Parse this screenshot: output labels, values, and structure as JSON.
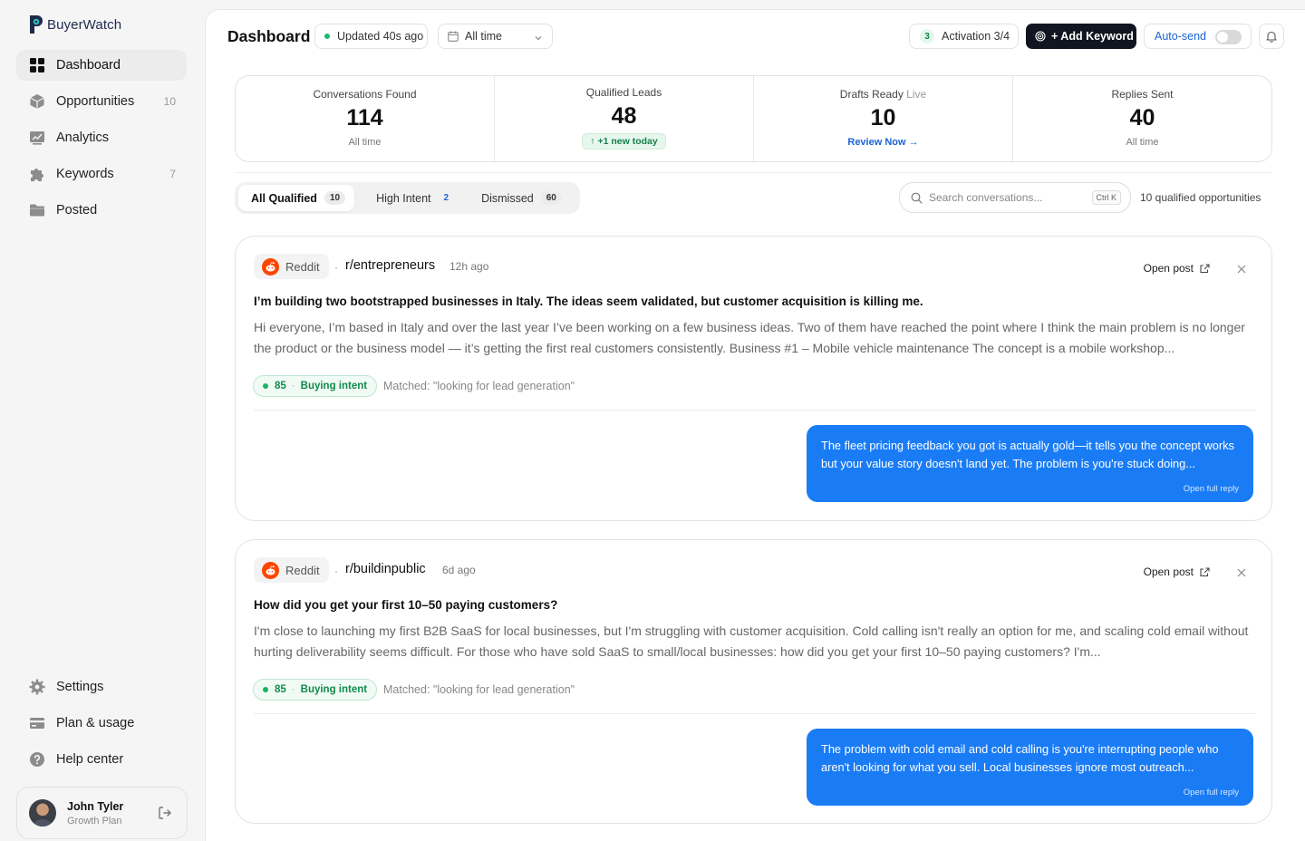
{
  "app": {
    "name": "BuyerWatch"
  },
  "sidebar": {
    "items": [
      {
        "label": "Dashboard",
        "count": ""
      },
      {
        "label": "Opportunities",
        "count": "10"
      },
      {
        "label": "Analytics",
        "count": ""
      },
      {
        "label": "Keywords",
        "count": "7"
      },
      {
        "label": "Posted",
        "count": ""
      }
    ],
    "bottom": [
      {
        "label": "Settings"
      },
      {
        "label": "Plan & usage"
      },
      {
        "label": "Help center"
      }
    ],
    "user": {
      "name": "John Tyler",
      "plan": "Growth Plan"
    }
  },
  "header": {
    "title": "Dashboard",
    "updated": "Updated 40s ago",
    "time_filter": "All time",
    "activation_num": "3",
    "activation_label": "Activation 3/4",
    "add_keyword": "+ Add Keyword",
    "autosend": "Auto-send"
  },
  "stats": [
    {
      "label": "Conversations Found",
      "value": "114",
      "sub": "All time"
    },
    {
      "label": "Qualified Leads",
      "value": "48",
      "sub": "+1 new today"
    },
    {
      "label": "Drafts Ready",
      "live": "Live",
      "value": "10",
      "sub": "Review Now →"
    },
    {
      "label": "Replies Sent",
      "value": "40",
      "sub": "All time"
    }
  ],
  "tabs": [
    {
      "label": "All Qualified",
      "count": "10"
    },
    {
      "label": "High Intent",
      "count": "2"
    },
    {
      "label": "Dismissed",
      "count": "60"
    }
  ],
  "search": {
    "placeholder": "Search conversations...",
    "shortcut": "Ctrl K"
  },
  "qualified_count": "10 qualified opportunities",
  "posts": [
    {
      "source": "Reddit",
      "subreddit": "r/entrepreneurs",
      "ago": "12h ago",
      "open_post": "Open post",
      "title": "I’m building two bootstrapped businesses in Italy. The ideas seem validated, but customer acquisition is killing me.",
      "body": "Hi everyone, I’m based in Italy and over the last year I’ve been working on a few business ideas. Two of them have reached the point where I think the main problem is no longer the product or the business model — it’s getting the first real customers consistently. Business #1 – Mobile vehicle maintenance The concept is a mobile workshop...",
      "score": "85",
      "intent": "Buying intent",
      "matched": "Matched: \"looking for lead generation\"",
      "reply": "The fleet pricing feedback you got is actually gold—it tells you the concept works but your value story doesn't land yet. The problem is you're stuck doing...",
      "reply_link": "Open full reply"
    },
    {
      "source": "Reddit",
      "subreddit": "r/buildinpublic",
      "ago": "6d ago",
      "open_post": "Open post",
      "title": "How did you get your first 10–50 paying customers?",
      "body": "I'm close to launching my first B2B SaaS for local businesses, but I'm struggling with customer acquisition. Cold calling isn't really an option for me, and scaling cold email without hurting deliverability seems difficult. For those who have sold SaaS to small/local businesses: how did you get your first 10–50 paying customers? I'm...",
      "score": "85",
      "intent": "Buying intent",
      "matched": "Matched: \"looking for lead generation\"",
      "reply": "The problem with cold email and cold calling is you're interrupting people who aren't looking for what you sell. Local businesses ignore most outreach...",
      "reply_link": "Open full reply"
    }
  ],
  "colors": {
    "accent": "#1a7cf5",
    "primary_button": "#11151f",
    "success": "#17b566",
    "link": "#1a63d6"
  }
}
